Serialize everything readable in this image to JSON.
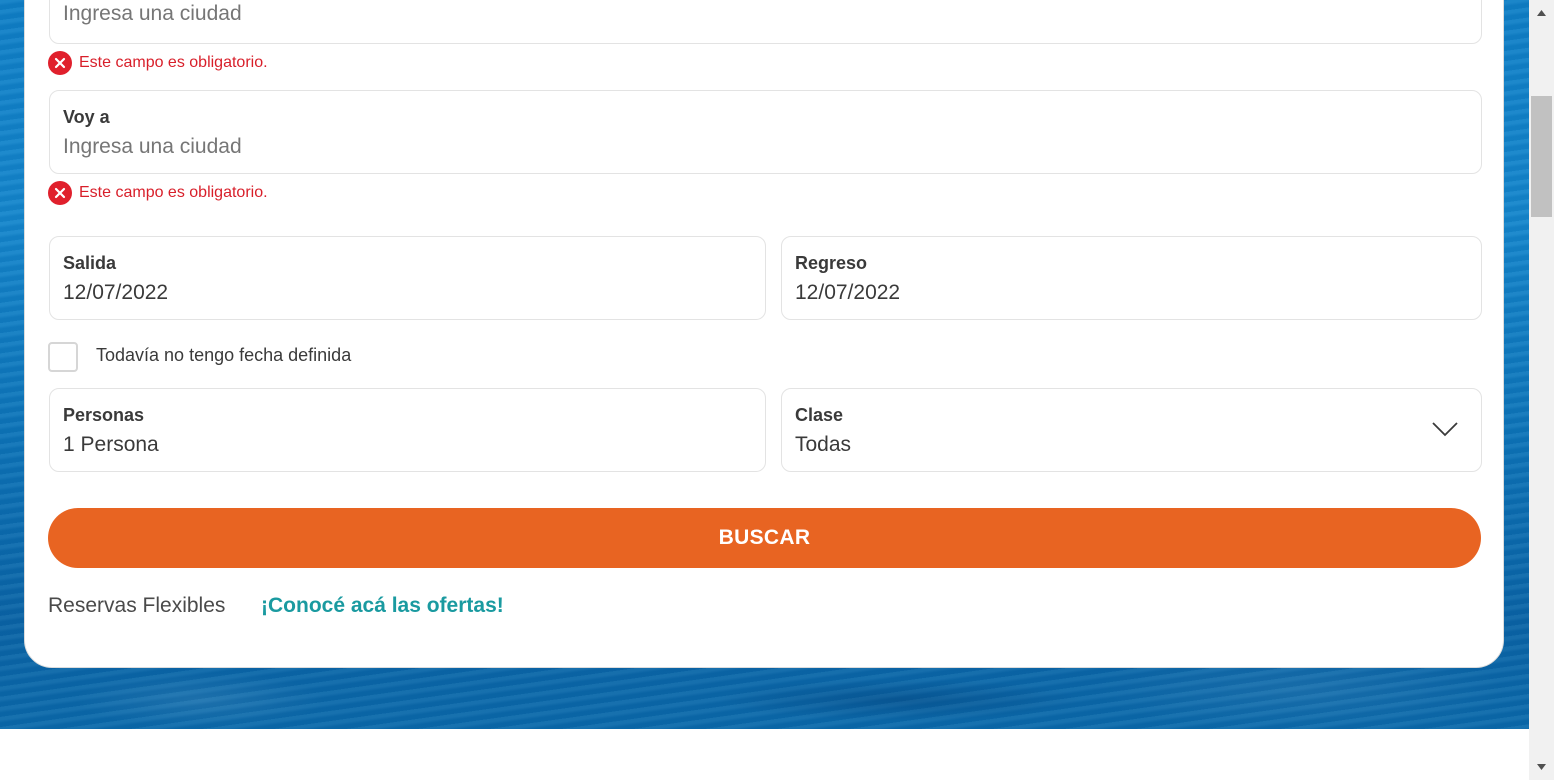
{
  "form": {
    "origin": {
      "placeholder": "Ingresa una ciudad",
      "error": "Este campo es obligatorio."
    },
    "destination": {
      "label": "Voy a",
      "placeholder": "Ingresa una ciudad",
      "error": "Este campo es obligatorio."
    },
    "departure": {
      "label": "Salida",
      "value": "12/07/2022"
    },
    "return": {
      "label": "Regreso",
      "value": "12/07/2022"
    },
    "no_date_checkbox": {
      "label": "Todavía no tengo fecha definida",
      "checked": false
    },
    "passengers": {
      "label": "Personas",
      "value": "1 Persona"
    },
    "cabin_class": {
      "label": "Clase",
      "value": "Todas"
    },
    "search_button": "BUSCAR"
  },
  "flexible": {
    "text": "Reservas Flexibles",
    "link": "¡Conocé acá las ofertas!"
  },
  "colors": {
    "accent_orange": "#e86422",
    "link_teal": "#1a9aa0",
    "error_red": "#d81f2a",
    "ocean_blue": "#0f7fc6"
  },
  "icons": {
    "error": "error-circle-x-icon",
    "dropdown": "chevron-down-icon",
    "scroll_up": "scroll-up-arrow-icon",
    "scroll_down": "scroll-down-arrow-icon"
  }
}
